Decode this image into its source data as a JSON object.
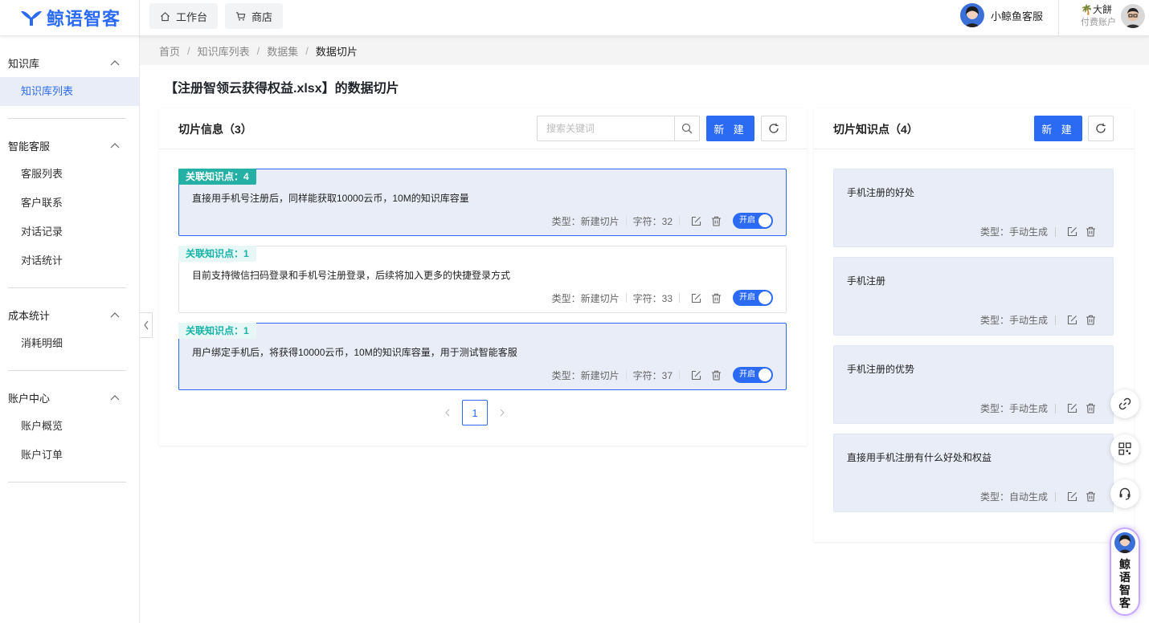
{
  "header": {
    "logo_text": "鲸语智客",
    "nav": [
      {
        "label": "工作台",
        "icon": "home-icon"
      },
      {
        "label": "商店",
        "icon": "cart-icon"
      }
    ],
    "agent_name": "小鲸鱼客服",
    "account_name": "大餅",
    "account_type": "付费账户"
  },
  "sidebar": {
    "groups": [
      {
        "title": "知识库",
        "items": [
          "知识库列表"
        ]
      },
      {
        "title": "智能客服",
        "items": [
          "客服列表",
          "客户联系",
          "对话记录",
          "对话统计"
        ]
      },
      {
        "title": "成本统计",
        "items": [
          "消耗明细"
        ]
      },
      {
        "title": "账户中心",
        "items": [
          "账户概览",
          "账户订单"
        ]
      }
    ],
    "active_item": "知识库列表"
  },
  "breadcrumb": [
    "首页",
    "知识库列表",
    "数据集",
    "数据切片"
  ],
  "page_title": "【注册智领云获得权益.xlsx】的数据切片",
  "slices_panel": {
    "title": "切片信息（3）",
    "search_placeholder": "搜索关键词",
    "new_label": "新 建",
    "items": [
      {
        "tag": "关联知识点：4",
        "text": "直接用手机号注册后，同样能获取10000云币，10M的知识库容量",
        "type": "类型：新建切片",
        "chars": "字符：32",
        "toggle": "开启",
        "selected": true
      },
      {
        "tag": "关联知识点：1",
        "text": "目前支持微信扫码登录和手机号注册登录，后续将加入更多的快捷登录方式",
        "type": "类型：新建切片",
        "chars": "字符：33",
        "toggle": "开启",
        "selected": false
      },
      {
        "tag": "关联知识点：1",
        "text": "用户绑定手机后，将获得10000云币，10M的知识库容量，用于测试智能客服",
        "type": "类型：新建切片",
        "chars": "字符：37",
        "toggle": "开启",
        "selected": true
      }
    ],
    "page": "1"
  },
  "points_panel": {
    "title": "切片知识点（4）",
    "new_label": "新 建",
    "items": [
      {
        "text": "手机注册的好处",
        "type": "类型：手动生成"
      },
      {
        "text": "手机注册",
        "type": "类型：手动生成"
      },
      {
        "text": "手机注册的优势",
        "type": "类型：手动生成"
      },
      {
        "text": "直接用手机注册有什么好处和权益",
        "type": "类型：自动生成"
      }
    ]
  },
  "floating": {
    "brand_text": "鲸语智客",
    "buttons": [
      "link-icon",
      "grid-icon",
      "headset-icon"
    ]
  },
  "colors": {
    "accent": "#2b6bf3",
    "tag": "#25b0a5",
    "selected_bg": "#e9edf8"
  }
}
